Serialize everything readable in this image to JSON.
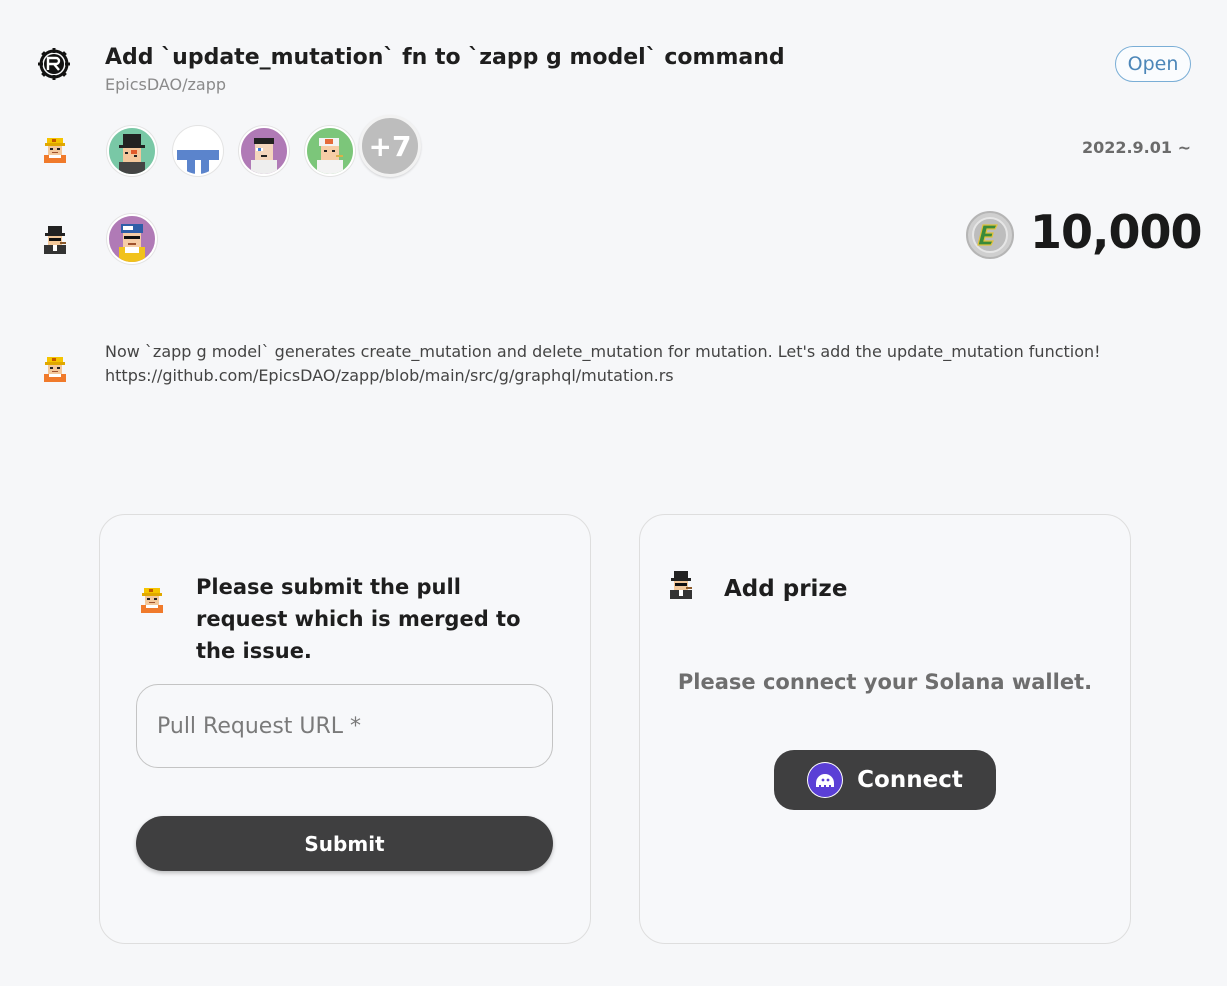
{
  "issue": {
    "title": "Add `update_mutation` fn to `zapp g model` command",
    "repo": "EpicsDAO/zapp",
    "status": "Open",
    "repo_logo": "rust-logo-icon"
  },
  "contributors": {
    "row_icon": "builder-character-icon",
    "avatars": [
      "tophat-avatar",
      "blue-block-avatar",
      "purple-avatar",
      "cap-avatar"
    ],
    "more_label": "+7",
    "date_range": "2022.9.01 ~"
  },
  "sponsors": {
    "row_icon": "tophat-character-icon",
    "avatars": [
      "blue-cap-avatar"
    ],
    "coin_icon": "epics-coin-icon",
    "amount": "10,000"
  },
  "description": {
    "icon": "builder-character-icon",
    "line1": "Now `zapp g model` generates create_mutation and delete_mutation for mutation. Let's add the update_mutation function!",
    "line2": "https://github.com/EpicsDAO/zapp/blob/main/src/g/graphql/mutation.rs"
  },
  "submit_card": {
    "heading": "Please submit the pull request which is merged to the issue.",
    "input_placeholder": "Pull Request URL *",
    "submit_label": "Submit"
  },
  "prize_card": {
    "heading": "Add prize",
    "message": "Please connect your Solana wallet.",
    "connect_label": "Connect",
    "connect_icon": "phantom-wallet-icon"
  },
  "colors": {
    "background": "#f6f7f9",
    "button_dark": "#3f3f40",
    "status_border": "#7aaed6",
    "status_text": "#4c86b8",
    "phantom_purple": "#5b3fd6"
  }
}
